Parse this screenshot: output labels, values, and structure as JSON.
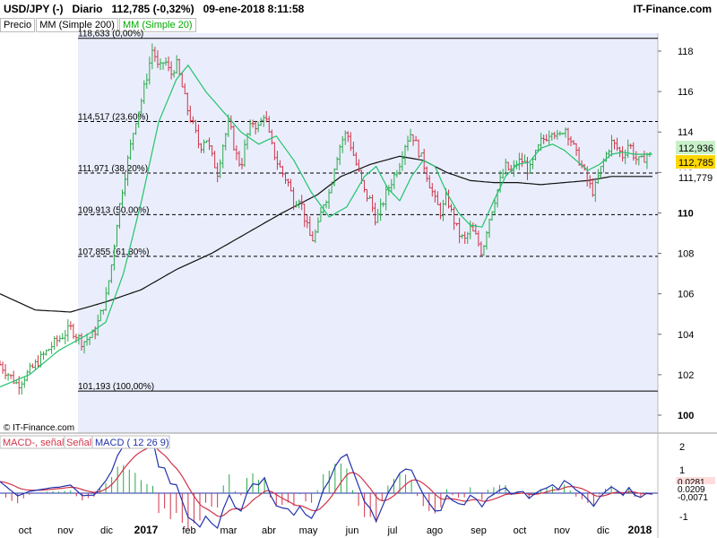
{
  "header": {
    "symbol": "USD/JPY (-)",
    "period": "Diario",
    "price": "112,785 (-0,32%)",
    "datetime": "09-ene-2018 8:11:58",
    "brand": "IT-Finance.com"
  },
  "tabs": [
    {
      "label": "Precio"
    },
    {
      "label": "MM (Simple 200)"
    },
    {
      "label": "MM (Simple 20)"
    }
  ],
  "watermark": "© IT-Finance.com",
  "macd_legend": {
    "a": "MACD-, señal",
    "b": "Señal",
    "c": "MACD ( 12 26 9)"
  },
  "colors": {
    "plot_bg": "#eaeefc",
    "up": "#2aa84a",
    "down": "#d0344a",
    "ma20": "#22c36a",
    "ma200": "#111111",
    "price_tag": "#ffd700",
    "ma20_tag": "#c8f0c8"
  },
  "chart_data": [
    {
      "type": "candlestick",
      "y_ticks": [
        "118",
        "116",
        "114",
        "112",
        "110",
        "108",
        "106",
        "104",
        "102",
        "100"
      ],
      "ylim": [
        99.8,
        119.0
      ],
      "x_ticks": [
        "oct",
        "nov",
        "dic",
        "2017",
        "feb",
        "mar",
        "abr",
        "may",
        "jun",
        "jul",
        "ago",
        "sep",
        "oct",
        "nov",
        "dic",
        "2018"
      ],
      "fib_levels": [
        {
          "value": 118.633,
          "label": "118,633 (0,00%)"
        },
        {
          "value": 114.517,
          "label": "114,517 (23,60%)"
        },
        {
          "value": 111.971,
          "label": "111,971 (38,20%)"
        },
        {
          "value": 109.913,
          "label": "109,913 (50,00%)"
        },
        {
          "value": 107.855,
          "label": "107,855 (61,80%)"
        },
        {
          "value": 101.193,
          "label": "101,193 (100,00%)"
        }
      ],
      "last_values": [
        {
          "name": "MM (Simple 20)",
          "value": 112.936,
          "label": "112,936"
        },
        {
          "name": "Precio",
          "value": 112.785,
          "label": "112,785"
        },
        {
          "name": "MM (Simple 200)",
          "value": 111.779,
          "label": "111,779"
        }
      ],
      "price_path": [
        [
          0,
          102.5
        ],
        [
          3,
          101.5
        ],
        [
          6,
          102.5
        ],
        [
          9,
          103.5
        ],
        [
          12,
          104.3
        ],
        [
          14,
          103.6
        ],
        [
          16,
          104.0
        ],
        [
          18,
          105.8
        ],
        [
          19,
          107.5
        ],
        [
          20,
          109.8
        ],
        [
          21,
          111.5
        ],
        [
          22,
          113.0
        ],
        [
          23,
          114.5
        ],
        [
          24,
          115.5
        ],
        [
          25,
          116.8
        ],
        [
          26,
          118.2
        ],
        [
          27,
          117.0
        ],
        [
          28,
          117.6
        ],
        [
          29,
          116.8
        ],
        [
          30,
          117.4
        ],
        [
          31,
          116.2
        ],
        [
          32,
          115.0
        ],
        [
          33,
          114.2
        ],
        [
          34,
          113.2
        ],
        [
          35,
          113.8
        ],
        [
          36,
          112.8
        ],
        [
          37,
          112.0
        ],
        [
          38,
          113.5
        ],
        [
          39,
          114.5
        ],
        [
          40,
          113.0
        ],
        [
          41,
          112.3
        ],
        [
          42,
          113.8
        ],
        [
          43,
          114.5
        ],
        [
          44,
          114.2
        ],
        [
          45,
          115.0
        ],
        [
          46,
          113.5
        ],
        [
          47,
          112.6
        ],
        [
          48,
          112.0
        ],
        [
          49,
          111.5
        ],
        [
          50,
          110.5
        ],
        [
          51,
          110.8
        ],
        [
          52,
          109.5
        ],
        [
          53,
          108.6
        ],
        [
          54,
          109.2
        ],
        [
          55,
          110.5
        ],
        [
          56,
          111.0
        ],
        [
          57,
          112.5
        ],
        [
          58,
          113.5
        ],
        [
          59,
          114.0
        ],
        [
          60,
          113.0
        ],
        [
          61,
          112.0
        ],
        [
          62,
          111.0
        ],
        [
          63,
          110.6
        ],
        [
          64,
          109.6
        ],
        [
          65,
          110.4
        ],
        [
          66,
          111.2
        ],
        [
          67,
          111.8
        ],
        [
          68,
          112.5
        ],
        [
          69,
          113.5
        ],
        [
          70,
          114.0
        ],
        [
          71,
          113.2
        ],
        [
          72,
          112.5
        ],
        [
          73,
          111.5
        ],
        [
          74,
          110.6
        ],
        [
          75,
          110.0
        ],
        [
          76,
          110.8
        ],
        [
          77,
          109.8
        ],
        [
          78,
          109.0
        ],
        [
          79,
          108.6
        ],
        [
          80,
          109.2
        ],
        [
          81,
          108.8
        ],
        [
          82,
          108.0
        ],
        [
          83,
          109.5
        ],
        [
          84,
          110.5
        ],
        [
          85,
          111.5
        ],
        [
          86,
          112.3
        ],
        [
          87,
          112.0
        ],
        [
          88,
          112.5
        ],
        [
          89,
          112.6
        ],
        [
          90,
          112.0
        ],
        [
          91,
          112.8
        ],
        [
          92,
          113.5
        ],
        [
          93,
          113.8
        ],
        [
          94,
          114.2
        ],
        [
          95,
          113.6
        ],
        [
          96,
          114.3
        ],
        [
          97,
          113.7
        ],
        [
          98,
          112.9
        ],
        [
          99,
          112.3
        ],
        [
          100,
          111.5
        ],
        [
          101,
          111.0
        ],
        [
          102,
          112.0
        ],
        [
          103,
          112.8
        ],
        [
          104,
          113.5
        ],
        [
          105,
          113.2
        ],
        [
          106,
          112.8
        ],
        [
          107,
          113.5
        ],
        [
          108,
          112.7
        ],
        [
          109,
          112.5
        ],
        [
          110,
          112.9
        ],
        [
          111,
          112.8
        ]
      ],
      "ma20_path": [
        [
          0,
          101.4
        ],
        [
          5,
          102.0
        ],
        [
          10,
          103.2
        ],
        [
          15,
          104.0
        ],
        [
          18,
          104.6
        ],
        [
          21,
          107.0
        ],
        [
          24,
          110.5
        ],
        [
          27,
          114.5
        ],
        [
          30,
          116.6
        ],
        [
          32,
          117.3
        ],
        [
          35,
          116.0
        ],
        [
          38,
          115.0
        ],
        [
          41,
          114.0
        ],
        [
          44,
          113.4
        ],
        [
          47,
          113.8
        ],
        [
          50,
          112.6
        ],
        [
          53,
          111.0
        ],
        [
          56,
          109.8
        ],
        [
          59,
          110.3
        ],
        [
          62,
          111.8
        ],
        [
          64,
          112.3
        ],
        [
          66,
          111.2
        ],
        [
          68,
          110.6
        ],
        [
          70,
          111.8
        ],
        [
          72,
          112.6
        ],
        [
          74,
          112.3
        ],
        [
          76,
          111.0
        ],
        [
          78,
          110.0
        ],
        [
          80,
          109.4
        ],
        [
          82,
          109.3
        ],
        [
          84,
          110.6
        ],
        [
          86,
          111.8
        ],
        [
          88,
          112.4
        ],
        [
          90,
          112.5
        ],
        [
          92,
          113.2
        ],
        [
          94,
          113.4
        ],
        [
          96,
          113.1
        ],
        [
          98,
          112.6
        ],
        [
          100,
          112.1
        ],
        [
          102,
          112.4
        ],
        [
          104,
          112.9
        ],
        [
          106,
          113.0
        ],
        [
          108,
          112.9
        ],
        [
          111,
          112.9
        ]
      ],
      "ma200_path": [
        [
          0,
          106.0
        ],
        [
          6,
          105.2
        ],
        [
          12,
          105.1
        ],
        [
          18,
          105.6
        ],
        [
          24,
          106.2
        ],
        [
          30,
          107.2
        ],
        [
          36,
          108.0
        ],
        [
          42,
          109.0
        ],
        [
          48,
          110.0
        ],
        [
          54,
          110.9
        ],
        [
          58,
          111.8
        ],
        [
          63,
          112.4
        ],
        [
          68,
          112.8
        ],
        [
          72,
          112.6
        ],
        [
          76,
          112.0
        ],
        [
          80,
          111.6
        ],
        [
          84,
          111.5
        ],
        [
          88,
          111.5
        ],
        [
          92,
          111.4
        ],
        [
          96,
          111.5
        ],
        [
          100,
          111.6
        ],
        [
          104,
          111.8
        ],
        [
          108,
          111.8
        ],
        [
          111,
          111.8
        ]
      ],
      "macd_y_ticks": [
        "2",
        "1",
        "-1"
      ],
      "macd_last": [
        {
          "label": "0,0281"
        },
        {
          "label": "0,0209"
        },
        {
          "label": "-0,0071"
        }
      ]
    }
  ]
}
